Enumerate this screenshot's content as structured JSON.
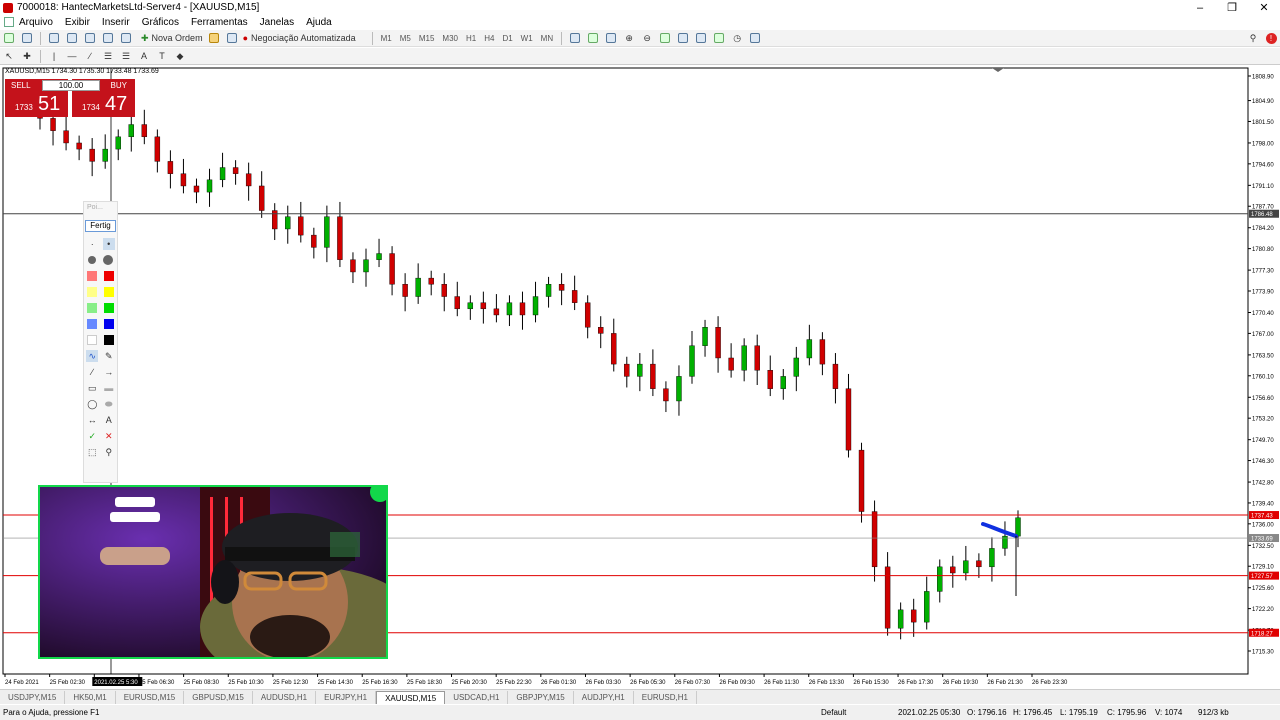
{
  "window": {
    "title": "7000018: HantecMarketsLtd-Server4 - [XAUUSD,M15]"
  },
  "menu": [
    "Arquivo",
    "Exibir",
    "Inserir",
    "Gráficos",
    "Ferramentas",
    "Janelas",
    "Ajuda"
  ],
  "toolbar": {
    "new_order": "Nova Ordem",
    "auto_trading": "Negociação Automatizada",
    "timeframes": [
      "M1",
      "M5",
      "M15",
      "M30",
      "H1",
      "H4",
      "D1",
      "W1",
      "MN"
    ]
  },
  "chart": {
    "symbol_info": "XAUUSD,M15 1734.30 1735.30 1733.48 1733.69",
    "sell_label": "SELL",
    "buy_label": "BUY",
    "lot": "100.00",
    "sell_price_small": "1733",
    "sell_price_big": "51",
    "buy_price_small": "1734",
    "buy_price_big": "47",
    "current_price": "1733.69"
  },
  "palette": {
    "title": "Poi...",
    "done": "Fertig"
  },
  "chart_data": {
    "type": "candlestick",
    "price_axis": [
      "1808.90",
      "1804.90",
      "1801.50",
      "1798.00",
      "1794.60",
      "1791.10",
      "1787.70",
      "1784.20",
      "1780.80",
      "1777.30",
      "1773.90",
      "1770.40",
      "1767.00",
      "1763.50",
      "1760.10",
      "1756.60",
      "1753.20",
      "1749.70",
      "1746.30",
      "1742.80",
      "1739.40",
      "1736.00",
      "1732.50",
      "1729.10",
      "1725.60",
      "1722.20",
      "1718.70",
      "1715.30"
    ],
    "time_axis": [
      "24 Feb 2021",
      "25 Feb 02:30",
      "2021.02.25 5:30",
      "25 Feb 06:30",
      "25 Feb 08:30",
      "25 Feb 10:30",
      "25 Feb 12:30",
      "25 Feb 14:30",
      "25 Feb 16:30",
      "25 Feb 18:30",
      "25 Feb 20:30",
      "25 Feb 22:30",
      "26 Feb 01:30",
      "26 Feb 03:30",
      "26 Feb 05:30",
      "26 Feb 07:30",
      "26 Feb 09:30",
      "26 Feb 11:30",
      "26 Feb 13:30",
      "26 Feb 15:30",
      "26 Feb 17:30",
      "26 Feb 19:30",
      "26 Feb 21:30",
      "26 Feb 23:30"
    ],
    "hlines": [
      {
        "price": 1786.48,
        "label": "1786.48",
        "color": "#444444"
      },
      {
        "price": 1737.43,
        "label": "1737.43",
        "color": "#e00000"
      },
      {
        "price": 1727.57,
        "label": "1727.57",
        "color": "#e00000"
      },
      {
        "price": 1718.27,
        "label": "1718.27",
        "color": "#e00000"
      },
      {
        "price": 1733.69,
        "label": "1733.69",
        "color": "#888888"
      }
    ],
    "closes": [
      1802,
      1800,
      1798,
      1797,
      1795,
      1797,
      1799,
      1801,
      1799,
      1795,
      1793,
      1791,
      1790,
      1792,
      1794,
      1793,
      1791,
      1787,
      1784,
      1786,
      1783,
      1781,
      1786,
      1779,
      1777,
      1779,
      1780,
      1775,
      1773,
      1776,
      1775,
      1773,
      1771,
      1772,
      1771,
      1770,
      1772,
      1770,
      1773,
      1775,
      1774,
      1772,
      1768,
      1767,
      1762,
      1760,
      1762,
      1758,
      1756,
      1760,
      1765,
      1768,
      1763,
      1761,
      1765,
      1761,
      1758,
      1760,
      1763,
      1766,
      1762,
      1758,
      1748,
      1738,
      1729,
      1719,
      1722,
      1720,
      1725,
      1729,
      1728,
      1730,
      1729,
      1732,
      1734,
      1737
    ]
  },
  "tabs": [
    "USDJPY,M15",
    "HK50,M1",
    "EURUSD,M15",
    "GBPUSD,M15",
    "AUDUSD,H1",
    "EURJPY,H1",
    "XAUUSD,M15",
    "USDCAD,H1",
    "GBPJPY,M15",
    "AUDJPY,H1",
    "EURUSD,H1"
  ],
  "active_tab": "XAUUSD,M15",
  "status": {
    "help": "Para o Ajuda, pressione F1",
    "profile": "Default",
    "time": "2021.02.25 05:30",
    "open": "O: 1796.16",
    "high": "H: 1796.45",
    "low": "L: 1795.19",
    "close": "C: 1795.96",
    "volume": "V: 1074",
    "traffic": "912/3 kb"
  },
  "colors": {
    "bull": "#00b000",
    "bear": "#d00000",
    "wick": "#000000",
    "sell": "#c4121b",
    "webcam_border": "#12d84a"
  }
}
